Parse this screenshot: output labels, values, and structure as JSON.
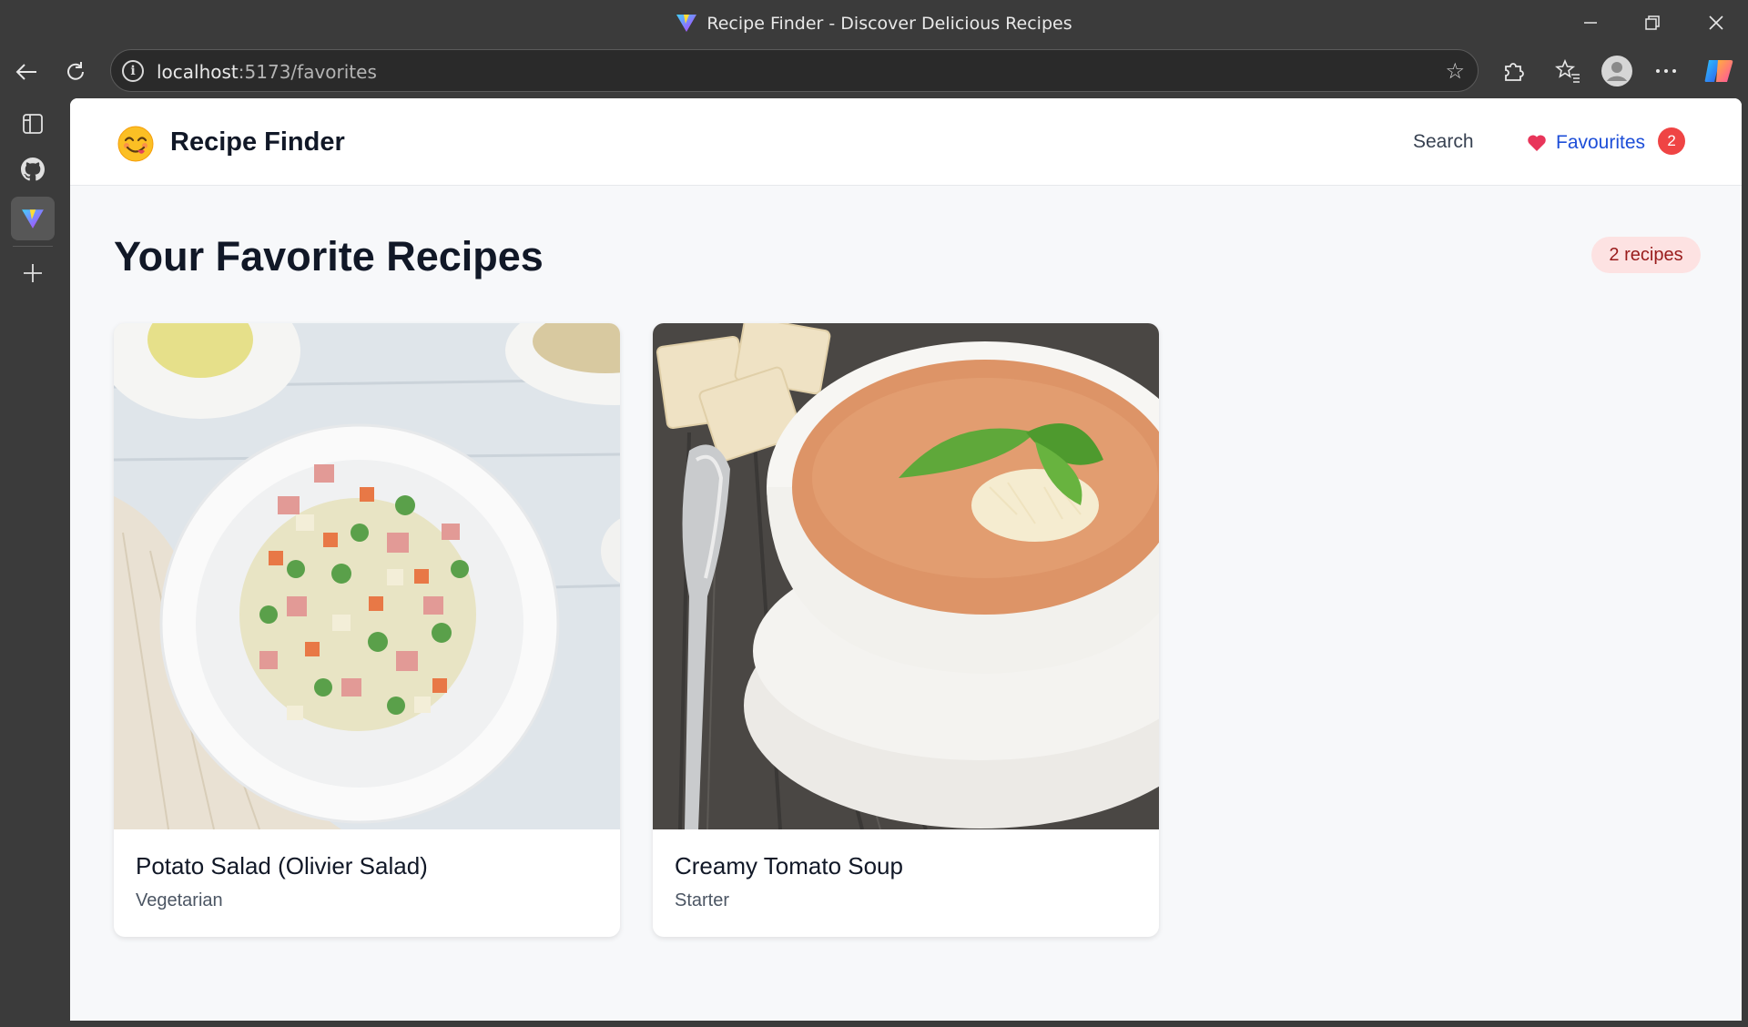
{
  "browser": {
    "window_title": "Recipe Finder - Discover Delicious Recipes",
    "url_host": "localhost",
    "url_path": ":5173/favorites"
  },
  "header": {
    "brand": "Recipe Finder",
    "nav": {
      "search": "Search",
      "favourites": "Favourites",
      "favourites_count": "2"
    }
  },
  "main": {
    "title": "Your Favorite Recipes",
    "count_label": "2 recipes",
    "recipes": [
      {
        "name": "Potato Salad (Olivier Salad)",
        "category": "Vegetarian"
      },
      {
        "name": "Creamy Tomato Soup",
        "category": "Starter"
      }
    ]
  },
  "colors": {
    "accent": "#1d4ed8",
    "badge": "#ef4444",
    "pill_bg": "#fde2e2",
    "pill_text": "#991b1b"
  }
}
